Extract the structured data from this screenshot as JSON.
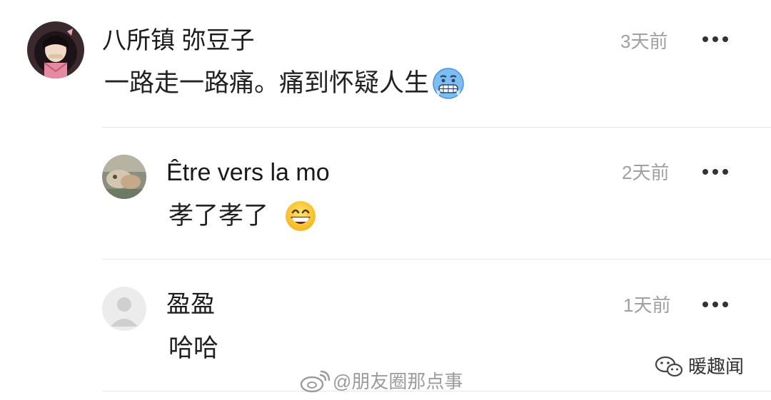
{
  "comments": [
    {
      "name": "八所镇 弥豆子",
      "time": "3天前",
      "text": "一路走一路痛。痛到怀疑人生",
      "emoji": "freezing-face"
    },
    {
      "name": "Être vers la mo",
      "time": "2天前",
      "text": "孝了孝了",
      "emoji": "grinning-face"
    },
    {
      "name": "盈盈",
      "time": "1天前",
      "text": "哈哈",
      "emoji": ""
    }
  ],
  "watermarks": {
    "weibo": "@朋友圈那点事",
    "weixin": "暖趣闻"
  },
  "icons": {
    "more": "more-dots-icon",
    "weibo": "weibo-logo-icon",
    "weixin": "wechat-logo-icon"
  },
  "colors": {
    "name": "#1a1a1a",
    "time": "#a0a0a0",
    "text": "#222222",
    "divider": "#e6e6e6",
    "more_dots": "#333333"
  }
}
